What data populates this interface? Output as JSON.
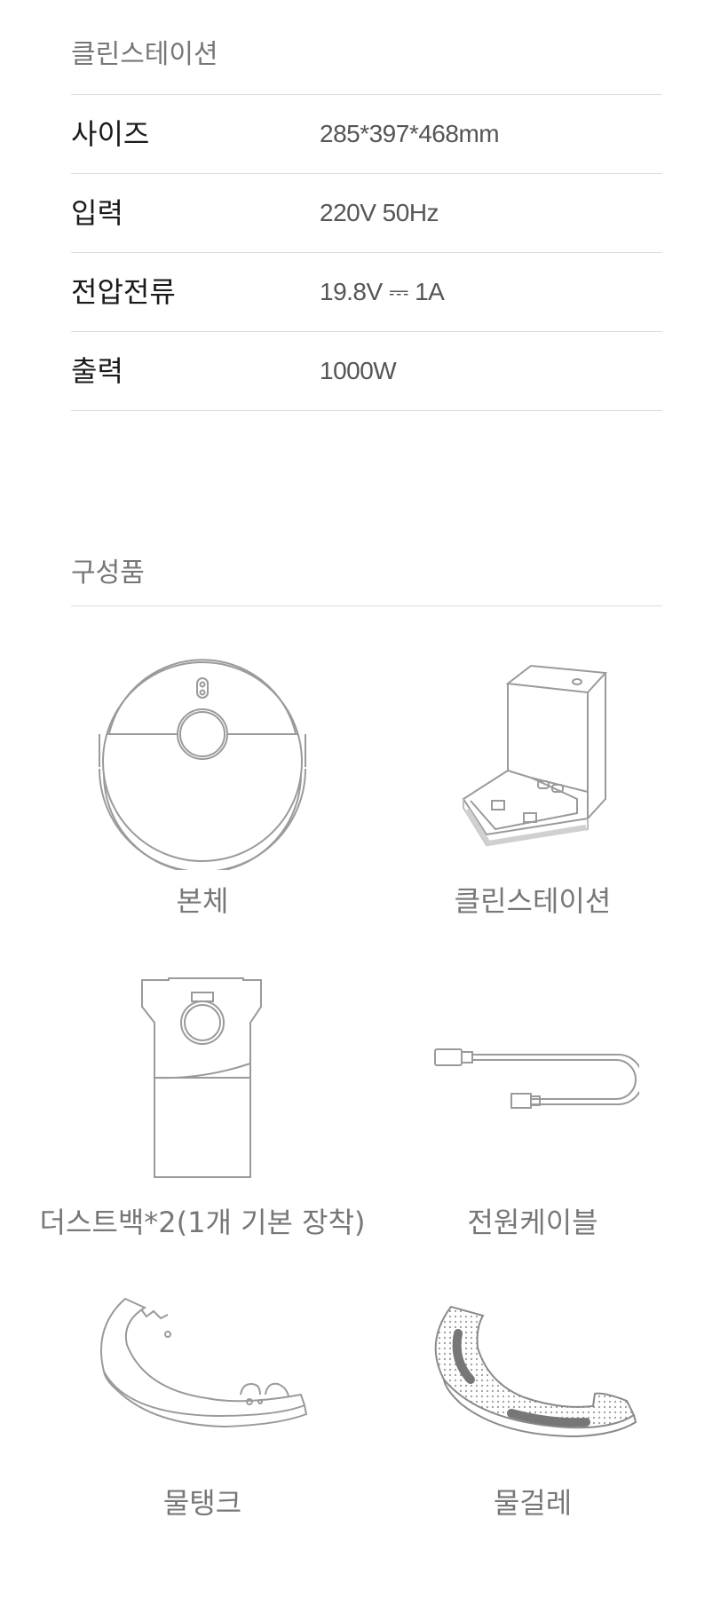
{
  "station_section": {
    "title": "클린스테이션",
    "specs": [
      {
        "label": "사이즈",
        "value": "285*397*468mm"
      },
      {
        "label": "입력",
        "value": "220V 50Hz"
      },
      {
        "label": "전압전류",
        "value": "19.8V ⎓ 1A"
      },
      {
        "label": "출력",
        "value": "1000W"
      }
    ]
  },
  "components_section": {
    "title": "구성품",
    "items": [
      {
        "label": "본체",
        "icon": "robot-vacuum-icon"
      },
      {
        "label": "클린스테이션",
        "icon": "clean-station-icon"
      },
      {
        "label": "더스트백*2(1개 기본 장착)",
        "icon": "dust-bag-icon"
      },
      {
        "label": "전원케이블",
        "icon": "power-cable-icon"
      },
      {
        "label": "물탱크",
        "icon": "water-tank-icon"
      },
      {
        "label": "물걸레",
        "icon": "mop-pad-icon"
      }
    ]
  },
  "colors": {
    "line": "#9a9a9a",
    "text": "#222222",
    "muted": "#777777"
  }
}
